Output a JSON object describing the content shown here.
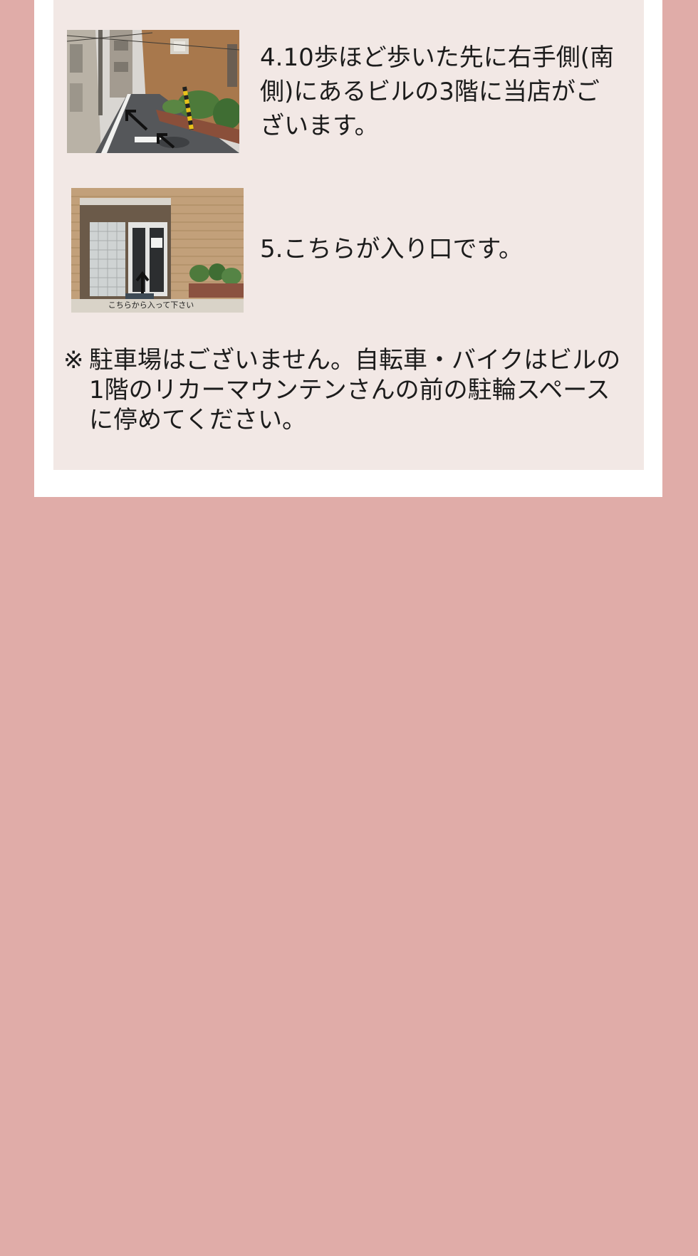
{
  "steps": [
    {
      "number": "4",
      "text": "4.10歩ほど歩いた先に右手側(南側)にあるビルの3階に当店がございます。",
      "photo": "street-with-arrows-photo"
    },
    {
      "number": "5",
      "text": "5.こちらが入り口です。",
      "photo": "building-entrance-photo",
      "photo_caption": "こちらから入って下さい"
    }
  ],
  "note": {
    "mark": "※",
    "text": "駐車場はございません。自転車・バイクはビルの1階のリカーマウンテンさんの前の駐輪スペースに停めてください。"
  },
  "colors": {
    "page_background": "#e0aca8",
    "card_background": "#ffffff",
    "panel_background": "#f2e8e5",
    "text": "#1c1c1c"
  }
}
